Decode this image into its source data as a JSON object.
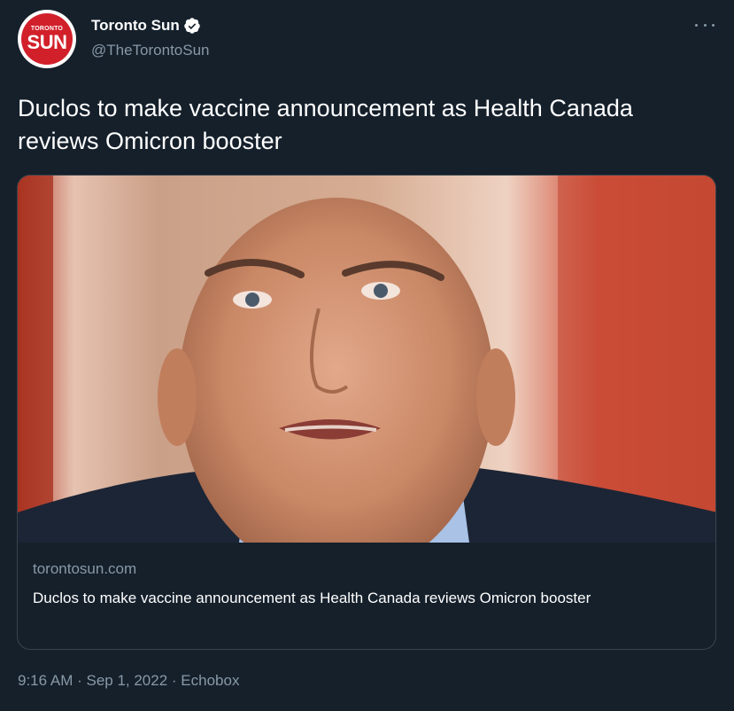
{
  "author": {
    "display_name": "Toronto Sun",
    "handle": "@TheTorontoSun",
    "verified": true,
    "avatar_logo_top": "TORONTO",
    "avatar_logo_main": "SUN"
  },
  "tweet": {
    "text": "Duclos to make vaccine announcement as Health Canada reviews Omicron booster"
  },
  "card": {
    "domain": "torontosun.com",
    "title": "Duclos to make vaccine announcement as Health Canada reviews Omicron booster"
  },
  "meta": {
    "time": "9:16 AM",
    "date": "Sep 1, 2022",
    "source": "Echobox",
    "separator": " · "
  },
  "colors": {
    "background": "#15202b",
    "secondary_text": "#8899a6",
    "verified_blue": "#ffffff",
    "brand_red": "#d2202a"
  }
}
